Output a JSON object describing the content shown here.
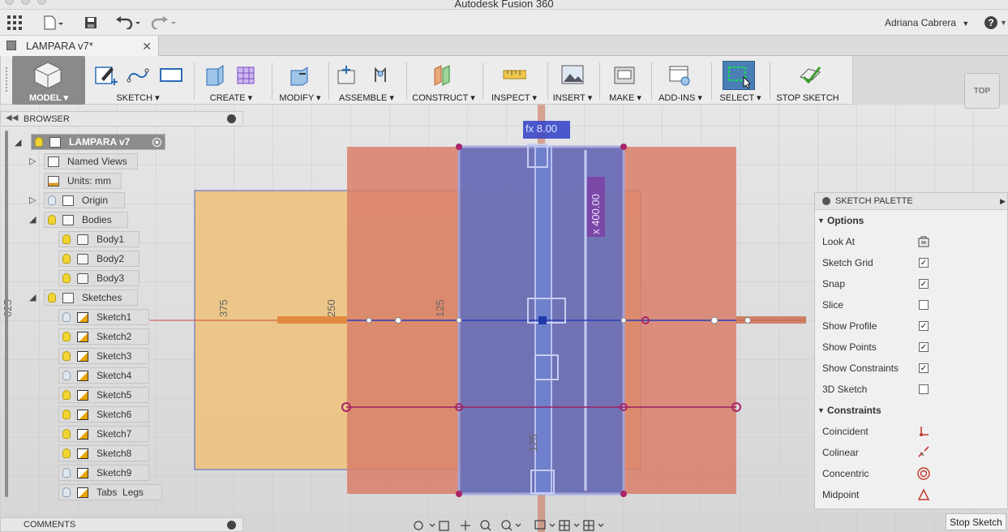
{
  "app": {
    "title": "Autodesk Fusion 360",
    "user": "Adriana Cabrera",
    "help": "?"
  },
  "doc_tab": {
    "name": "LAMPARA v7*"
  },
  "ribbon": {
    "workspace": "MODEL",
    "groups": [
      "SKETCH",
      "CREATE",
      "MODIFY",
      "ASSEMBLE",
      "CONSTRUCT",
      "INSPECT",
      "INSERT",
      "MAKE",
      "ADD-INS",
      "SELECT",
      "STOP SKETCH"
    ]
  },
  "browser": {
    "header": "BROWSER",
    "root": "LAMPARA v7",
    "named_views": "Named Views",
    "units": "Units: mm",
    "origin": "Origin",
    "bodies": "Bodies",
    "body_items": [
      "Body1",
      "Body2",
      "Body3"
    ],
    "sketches": "Sketches",
    "sketch_items": [
      "Sketch1",
      "Sketch2",
      "Sketch3",
      "Sketch4",
      "Sketch5",
      "Sketch6",
      "Sketch7",
      "Sketch8",
      "Sketch9",
      "Tabs  Legs"
    ]
  },
  "comments": {
    "label": "COMMENTS"
  },
  "viewcube": {
    "label": "TOP"
  },
  "canvas": {
    "dims": {
      "d625": "625",
      "d375": "375",
      "d250": "250",
      "d125a": "125",
      "d125b": "125"
    },
    "fx_label": "fx  8.00",
    "x_label": "x 400.00"
  },
  "palette": {
    "title": "SKETCH PALETTE",
    "options_title": "Options",
    "options": [
      {
        "label": "Look At",
        "type": "icon"
      },
      {
        "label": "Sketch Grid",
        "checked": true
      },
      {
        "label": "Snap",
        "checked": true
      },
      {
        "label": "Slice",
        "checked": false
      },
      {
        "label": "Show Profile",
        "checked": true
      },
      {
        "label": "Show Points",
        "checked": true
      },
      {
        "label": "Show Constraints",
        "checked": true
      },
      {
        "label": "3D Sketch",
        "checked": false
      }
    ],
    "constraints_title": "Constraints",
    "constraints": [
      {
        "label": "Coincident",
        "icon": "coincident-icon"
      },
      {
        "label": "Colinear",
        "icon": "colinear-icon"
      },
      {
        "label": "Concentric",
        "icon": "concentric-icon"
      },
      {
        "label": "Midpoint",
        "icon": "midpoint-icon"
      }
    ],
    "stop_sketch": "Stop Sketch"
  },
  "colors": {
    "accent_red": "#c0392b",
    "sketch_blue": "#3949c7",
    "constraint_magenta": "#b3246e",
    "body_orange": "#e8b56a"
  }
}
